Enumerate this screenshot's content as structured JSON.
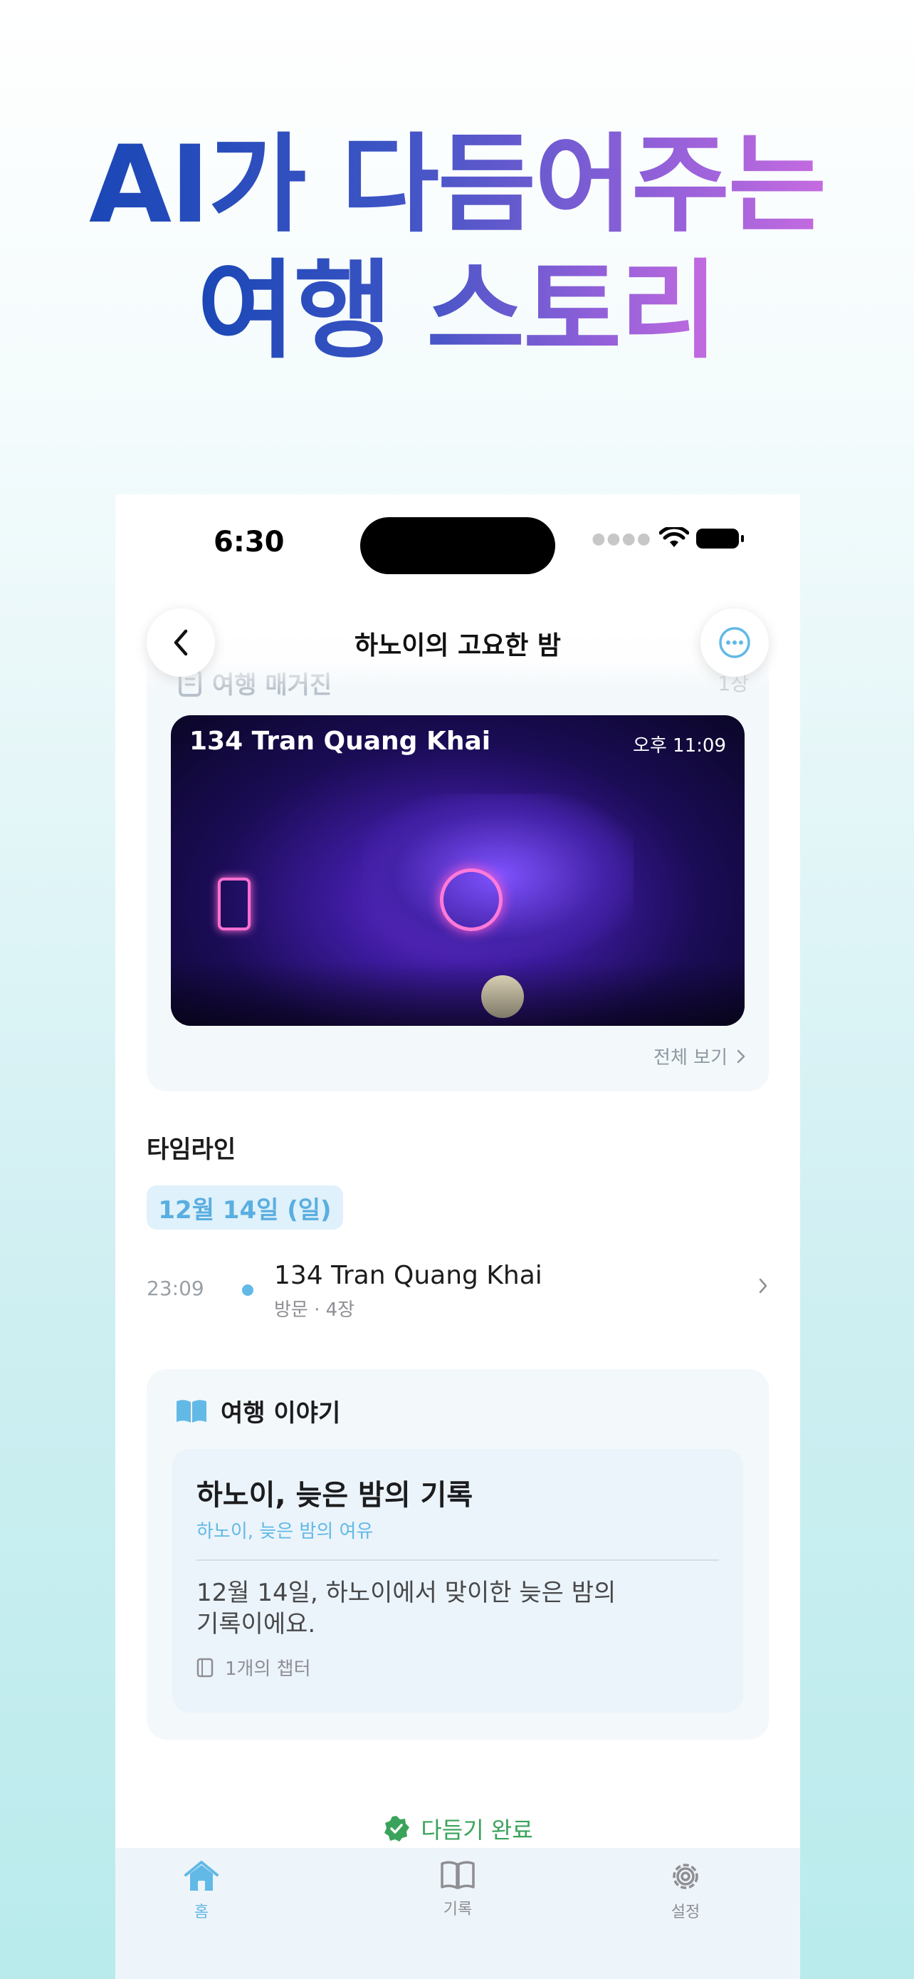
{
  "headline": {
    "line1": "AI가 다듬어주는",
    "line2": "여행 스토리"
  },
  "status_bar": {
    "time": "6:30"
  },
  "nav": {
    "title": "하노이의 고요한 밤"
  },
  "magazine": {
    "label": "여행 매거진",
    "count": "1장",
    "photo": {
      "place": "134 Tran Quang Khai",
      "time": "오후 11:09"
    },
    "view_all": "전체 보기"
  },
  "timeline": {
    "title": "타임라인",
    "date": "12월 14일 (일)",
    "entries": [
      {
        "time": "23:09",
        "place": "134 Tran Quang Khai",
        "meta": "방문  · 4장"
      }
    ]
  },
  "story": {
    "section_title": "여행 이야기",
    "title": "하노이, 늦은 밤의 기록",
    "subtitle": "하노이, 늦은 밤의 여유",
    "body": "12월 14일, 하노이에서 맞이한 늦은 밤의 기록이에요.",
    "chapters": "1개의 챕터"
  },
  "status_done": "다듬기 완료",
  "tabs": [
    {
      "label": "홈",
      "icon": "home-icon"
    },
    {
      "label": "기록",
      "icon": "book-icon"
    },
    {
      "label": "설정",
      "icon": "gear-icon"
    }
  ],
  "colors": {
    "accent": "#62b9e6",
    "success": "#3aa35b",
    "headline_start": "#1b47b6",
    "headline_end": "#c66be0"
  }
}
